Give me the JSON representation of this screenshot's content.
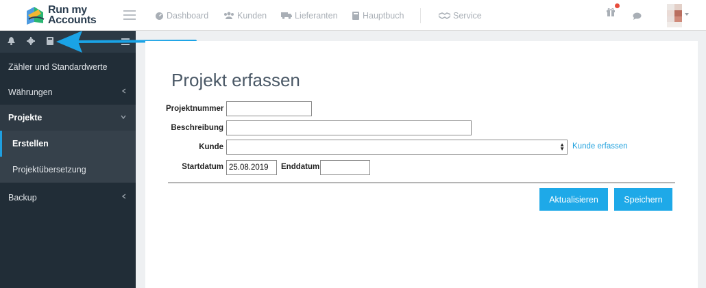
{
  "app": {
    "logo_line1": "Run my",
    "logo_line2": "Accounts"
  },
  "top_nav": [
    {
      "label": "Dashboard",
      "icon": "dashboard-gauge-icon"
    },
    {
      "label": "Kunden",
      "icon": "users-icon"
    },
    {
      "label": "Lieferanten",
      "icon": "truck-icon"
    },
    {
      "label": "Hauptbuch",
      "icon": "book-icon"
    },
    {
      "label": "Service",
      "icon": "handshake-icon"
    }
  ],
  "top_icons": {
    "gift": "gift-icon",
    "chat": "chat-bubble-icon",
    "notification_dot_color": "#e74c3c"
  },
  "sidebar": {
    "tools": [
      "bell-icon",
      "gear-icon",
      "book-icon",
      "list-icon"
    ],
    "items": [
      {
        "label": "Zähler und Standardwerte"
      },
      {
        "label": "Währungen"
      },
      {
        "label": "Projekte"
      },
      {
        "label": "Erstellen"
      },
      {
        "label": "Projektübersetzung"
      },
      {
        "label": "Backup"
      }
    ]
  },
  "form": {
    "title": "Projekt erfassen",
    "projektnummer_label": "Projektnummer",
    "projektnummer_value": "",
    "beschreibung_label": "Beschreibung",
    "beschreibung_value": "",
    "kunde_label": "Kunde",
    "kunde_value": "",
    "kunde_link": "Kunde erfassen",
    "startdatum_label": "Startdatum",
    "startdatum_value": "25.08.2019",
    "enddatum_label": "Enddatum",
    "enddatum_value": ""
  },
  "buttons": {
    "update": "Aktualisieren",
    "save": "Speichern"
  },
  "colors": {
    "accent": "#1ea9e8",
    "sidebar_bg": "#212d37",
    "arrow": "#1aa3e6"
  }
}
